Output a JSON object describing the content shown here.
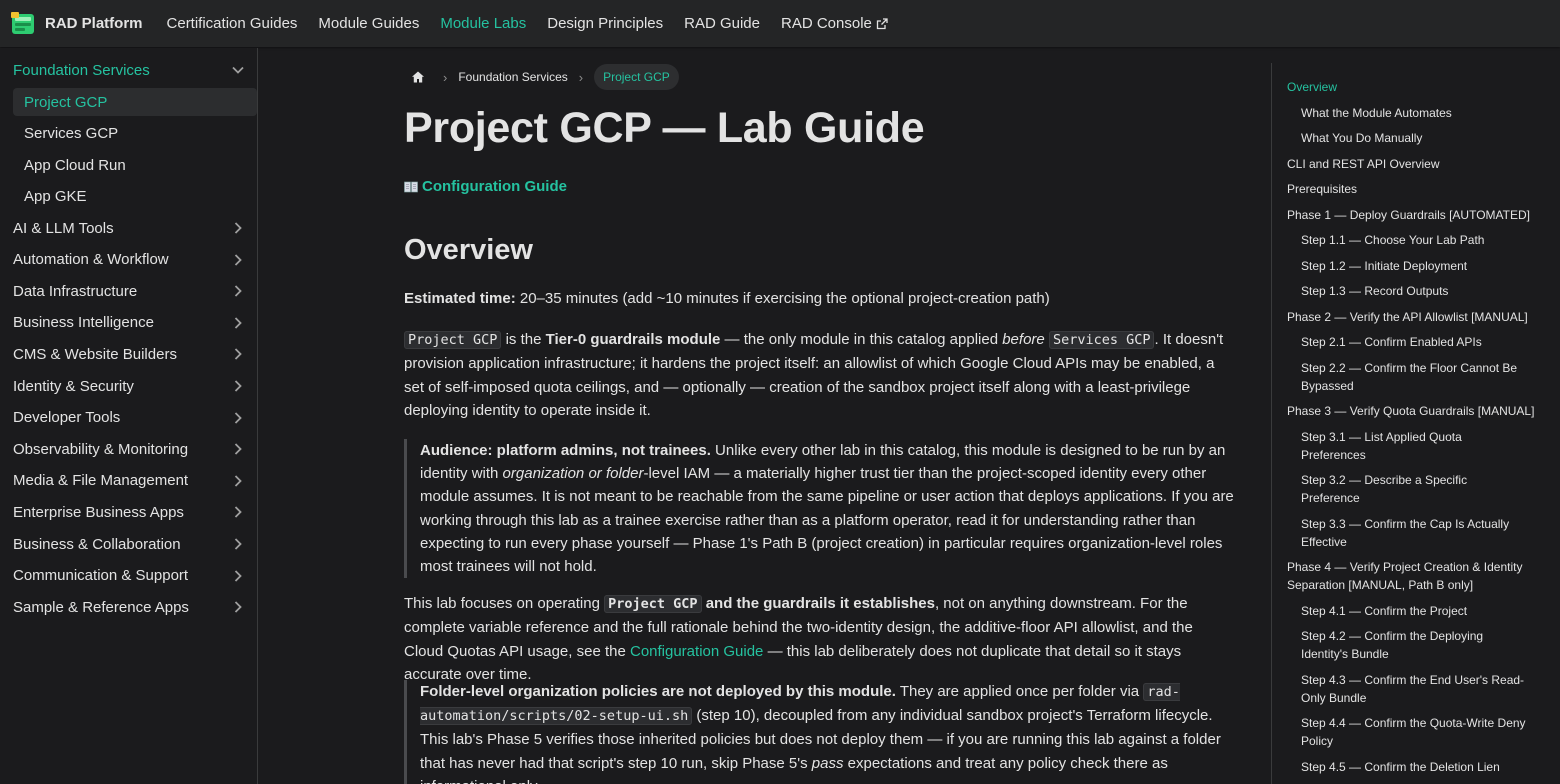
{
  "navbar": {
    "brand": "RAD Platform",
    "links": [
      {
        "label": "Certification Guides",
        "active": false
      },
      {
        "label": "Module Guides",
        "active": false
      },
      {
        "label": "Module Labs",
        "active": true
      },
      {
        "label": "Design Principles",
        "active": false
      },
      {
        "label": "RAD Guide",
        "active": false
      },
      {
        "label": "RAD Console",
        "active": false,
        "external": true
      }
    ]
  },
  "sidebar": {
    "foundation": {
      "label": "Foundation Services",
      "items": [
        "Project GCP",
        "Services GCP",
        "App Cloud Run",
        "App GKE"
      ],
      "active_item": "Project GCP"
    },
    "categories": [
      "AI & LLM Tools",
      "Automation & Workflow",
      "Data Infrastructure",
      "Business Intelligence",
      "CMS & Website Builders",
      "Identity & Security",
      "Developer Tools",
      "Observability & Monitoring",
      "Media & File Management",
      "Enterprise Business Apps",
      "Business & Collaboration",
      "Communication & Support",
      "Sample & Reference Apps"
    ]
  },
  "breadcrumb": {
    "items": [
      "Foundation Services",
      "Project GCP"
    ]
  },
  "main": {
    "title": "Project GCP — Lab Guide",
    "config_link": "Configuration Guide",
    "overview_heading": "Overview",
    "estimated_label": "Estimated time:",
    "estimated_value": " 20–35 minutes (add ~10 minutes if exercising the optional project-creation path)",
    "p1": {
      "code1": "Project GCP",
      "t1": " is the ",
      "b1": "Tier-0 guardrails module",
      "t2": " — the only module in this catalog applied ",
      "i1": "before",
      "t3": " ",
      "code2": "Services GCP",
      "t4": ". It doesn't provision application infrastructure; it hardens the project itself: an allowlist of which Google Cloud APIs may be enabled, a set of self-imposed quota ceilings, and — optionally — creation of the sandbox project itself along with a least-privilege deploying identity to operate inside it."
    },
    "q1": {
      "b1": "Audience: platform admins, not trainees.",
      "t1": " Unlike every other lab in this catalog, this module is designed to be run by an identity with ",
      "i1": "organization or folder",
      "t2": "-level IAM — a materially higher trust tier than the project-scoped identity every other module assumes. It is not meant to be reachable from the same pipeline or user action that deploys applications. If you are working through this lab as a trainee exercise rather than as a platform operator, read it for understanding rather than expecting to run every phase yourself — Phase 1's Path B (project creation) in particular requires organization-level roles most trainees will not hold."
    },
    "p2": {
      "t1": "This lab focuses on operating ",
      "code1": "Project GCP",
      "b1": " and the guardrails it establishes",
      "t2": ", not on anything downstream. For the complete variable reference and the full rationale behind the two-identity design, the additive-floor API allowlist, and the Cloud Quotas API usage, see the ",
      "link": "Configuration Guide",
      "t3": " — this lab deliberately does not duplicate that detail so it stays accurate over time."
    },
    "q2": {
      "b1": "Folder-level organization policies are not deployed by this module.",
      "t1": " They are applied once per folder via ",
      "code1": "rad-automation/scripts/02-setup-ui.sh",
      "t2": " (step 10), decoupled from any individual sandbox project's Terraform lifecycle. This lab's Phase 5 verifies those inherited policies but does not deploy them — if you are running this lab against a folder that has never had that script's step 10 run, skip Phase 5's ",
      "i1": "pass",
      "t3": " expectations and treat any policy check there as informational only."
    }
  },
  "toc": [
    {
      "label": "Overview",
      "level": 1,
      "active": true
    },
    {
      "label": "What the Module Automates",
      "level": 2
    },
    {
      "label": "What You Do Manually",
      "level": 2
    },
    {
      "label": "CLI and REST API Overview",
      "level": 1
    },
    {
      "label": "Prerequisites",
      "level": 1
    },
    {
      "label": "Phase 1 — Deploy Guardrails [AUTOMATED]",
      "level": 1
    },
    {
      "label": "Step 1.1 — Choose Your Lab Path",
      "level": 2
    },
    {
      "label": "Step 1.2 — Initiate Deployment",
      "level": 2
    },
    {
      "label": "Step 1.3 — Record Outputs",
      "level": 2
    },
    {
      "label": "Phase 2 — Verify the API Allowlist [MANUAL]",
      "level": 1
    },
    {
      "label": "Step 2.1 — Confirm Enabled APIs",
      "level": 2
    },
    {
      "label": "Step 2.2 — Confirm the Floor Cannot Be Bypassed",
      "level": 2
    },
    {
      "label": "Phase 3 — Verify Quota Guardrails [MANUAL]",
      "level": 1
    },
    {
      "label": "Step 3.1 — List Applied Quota Preferences",
      "level": 2
    },
    {
      "label": "Step 3.2 — Describe a Specific Preference",
      "level": 2
    },
    {
      "label": "Step 3.3 — Confirm the Cap Is Actually Effective",
      "level": 2
    },
    {
      "label": "Phase 4 — Verify Project Creation & Identity Separation [MANUAL, Path B only]",
      "level": 1
    },
    {
      "label": "Step 4.1 — Confirm the Project",
      "level": 2
    },
    {
      "label": "Step 4.2 — Confirm the Deploying Identity's Bundle",
      "level": 2
    },
    {
      "label": "Step 4.3 — Confirm the End User's Read-Only Bundle",
      "level": 2
    },
    {
      "label": "Step 4.4 — Confirm the Quota-Write Deny Policy",
      "level": 2
    },
    {
      "label": "Step 4.5 — Confirm the Deletion Lien",
      "level": 2
    }
  ],
  "colors": {
    "accent": "#25c2a0",
    "background": "#1b1b1d",
    "navbar": "#242526"
  },
  "icons": [
    "logo-icon",
    "external-link-icon",
    "chevron-down-icon",
    "chevron-right-icon",
    "home-icon",
    "book-icon"
  ]
}
